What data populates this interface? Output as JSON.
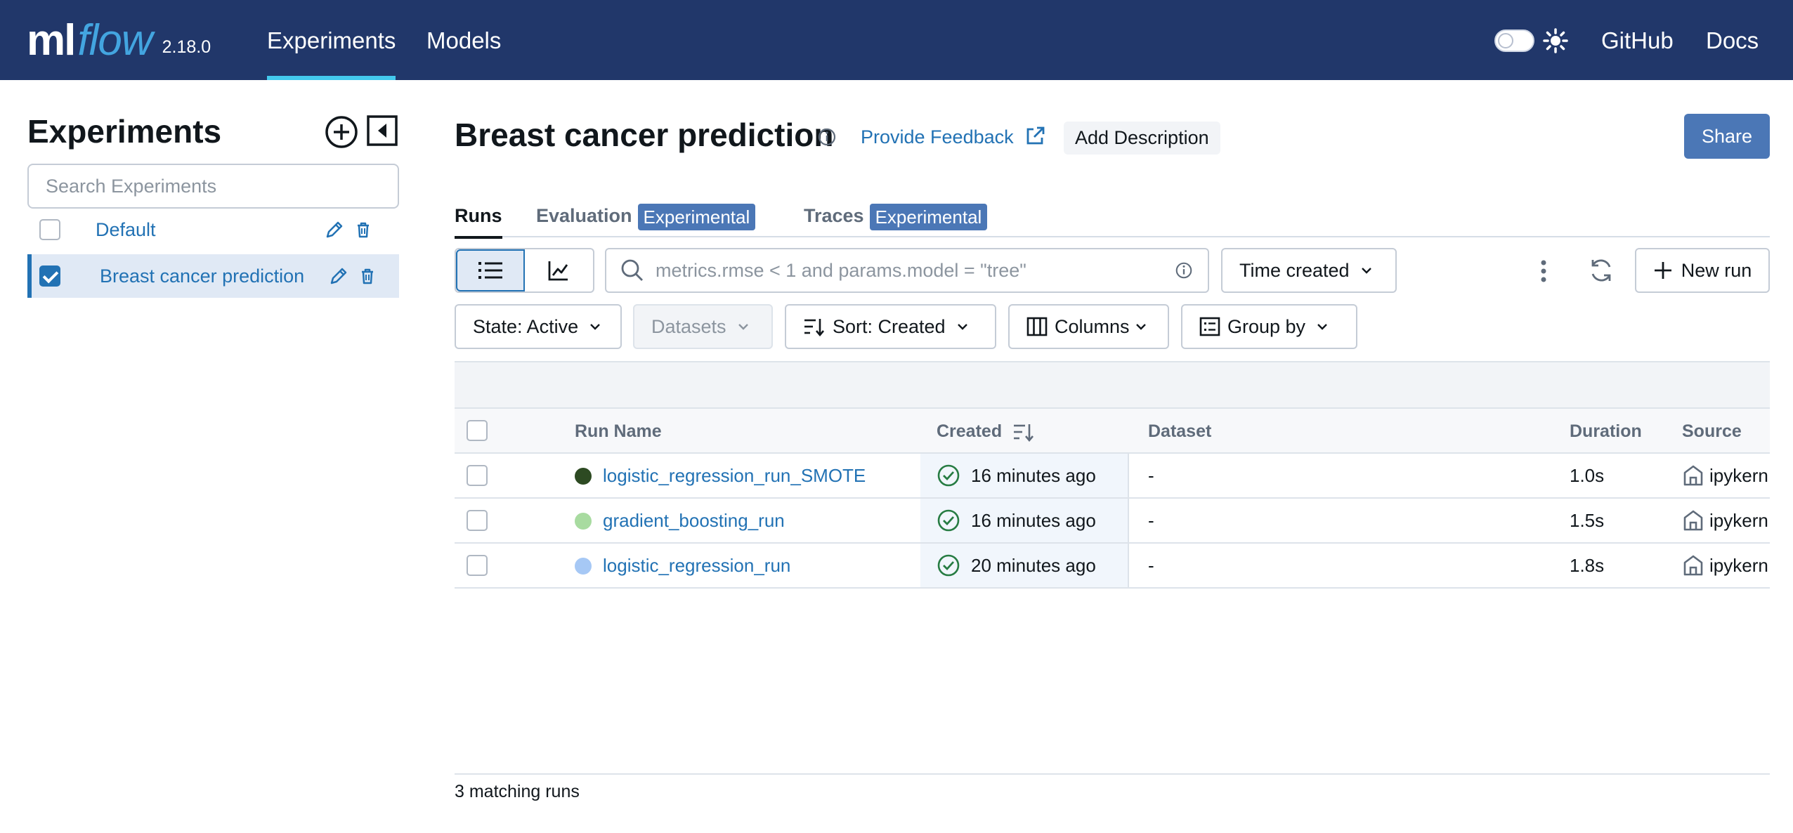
{
  "app": {
    "logo_ml": "ml",
    "logo_flow": "flow",
    "version": "2.18.0",
    "nav": [
      {
        "label": "Experiments",
        "active": true
      },
      {
        "label": "Models",
        "active": false
      }
    ],
    "links": {
      "github": "GitHub",
      "docs": "Docs"
    },
    "colors": {
      "topbar": "#21376a",
      "accent": "#2272b4",
      "nav_underline": "#43c9ed",
      "badge": "#4b77b6"
    }
  },
  "sidebar": {
    "title": "Experiments",
    "search_placeholder": "Search Experiments",
    "experiments": [
      {
        "name": "Default",
        "checked": false,
        "selected": false
      },
      {
        "name": "Breast cancer prediction",
        "checked": true,
        "selected": true
      }
    ]
  },
  "header": {
    "title": "Breast cancer prediction",
    "feedback": "Provide Feedback",
    "add_description": "Add Description",
    "share": "Share"
  },
  "tabs": [
    {
      "label": "Runs",
      "badge": "",
      "active": true
    },
    {
      "label": "Evaluation",
      "badge": "Experimental",
      "active": false
    },
    {
      "label": "Traces",
      "badge": "Experimental",
      "active": false
    }
  ],
  "toolbar": {
    "search_placeholder": "metrics.rmse < 1 and params.model = \"tree\"",
    "time_filter": "Time created",
    "new_run": "New run",
    "state": "State: Active",
    "datasets": "Datasets",
    "sort": "Sort: Created",
    "columns": "Columns",
    "group_by": "Group by"
  },
  "table": {
    "columns": [
      "Run Name",
      "Created",
      "Dataset",
      "Duration",
      "Source"
    ],
    "rows": [
      {
        "name": "logistic_regression_run_SMOTE",
        "color": "#2d4a22",
        "created": "16 minutes ago",
        "dataset": "-",
        "duration": "1.0s",
        "source": "ipykern..."
      },
      {
        "name": "gradient_boosting_run",
        "color": "#a8dba0",
        "created": "16 minutes ago",
        "dataset": "-",
        "duration": "1.5s",
        "source": "ipykern..."
      },
      {
        "name": "logistic_regression_run",
        "color": "#a6c8f5",
        "created": "20 minutes ago",
        "dataset": "-",
        "duration": "1.8s",
        "source": "ipykern..."
      }
    ]
  },
  "footer": {
    "matching": "3 matching runs"
  }
}
